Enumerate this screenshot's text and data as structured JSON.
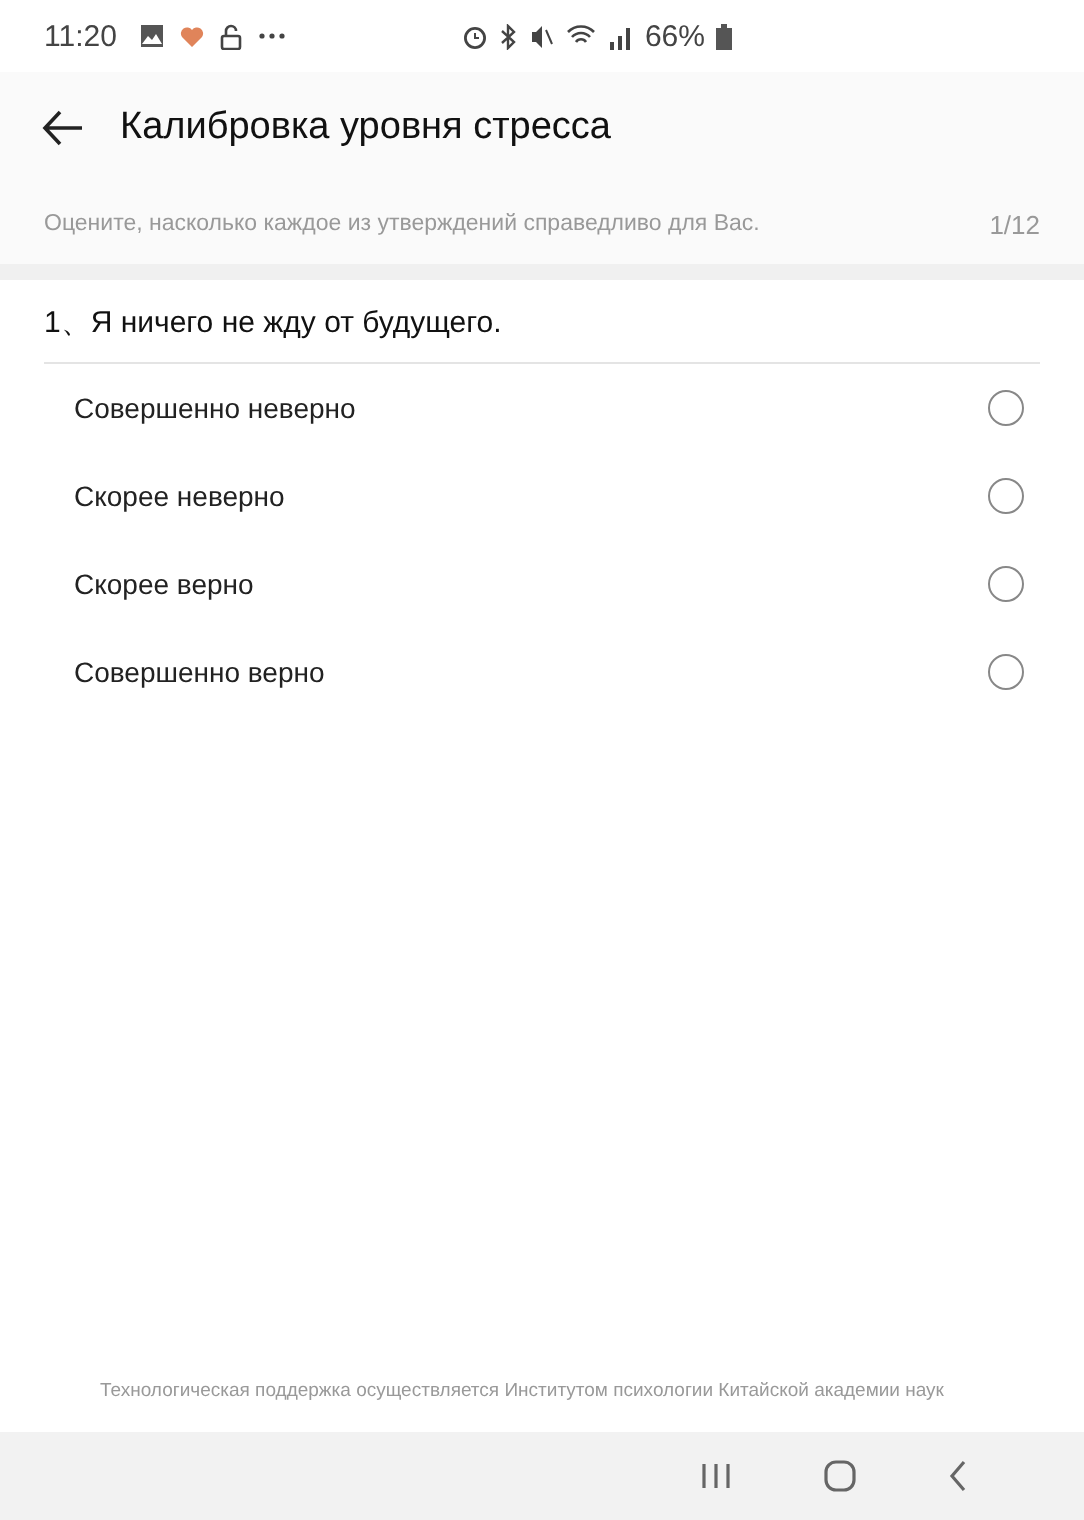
{
  "status_bar": {
    "time": "11:20",
    "battery": "66%"
  },
  "header": {
    "title": "Калибровка уровня стресса"
  },
  "instruction": {
    "text": "Оцените, насколько каждое из утверждений справедливо для Вас.",
    "progress": "1/12"
  },
  "question": {
    "number": "1、",
    "text": "Я ничего не жду от будущего."
  },
  "options": [
    {
      "label": "Совершенно неверно",
      "selected": false
    },
    {
      "label": "Скорее неверно",
      "selected": false
    },
    {
      "label": "Скорее верно",
      "selected": false
    },
    {
      "label": "Совершенно верно",
      "selected": false
    }
  ],
  "footer": {
    "text": "Технологическая поддержка осуществляется Институтом психологии Китайской академии наук"
  }
}
